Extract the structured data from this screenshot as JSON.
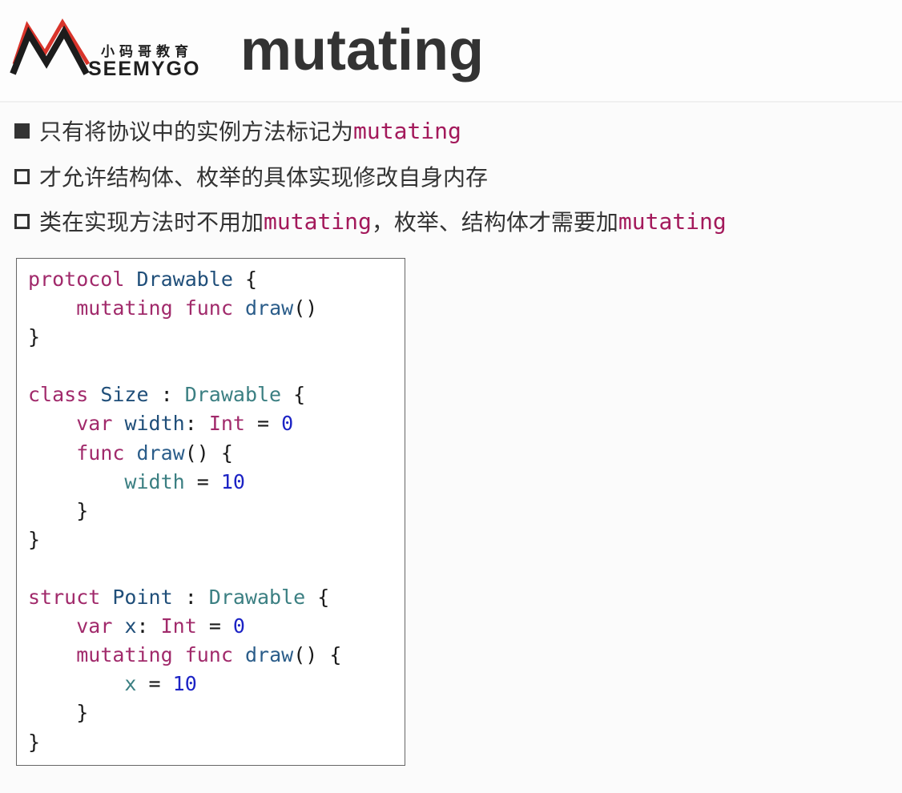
{
  "header": {
    "logo_cn": "小码哥教育",
    "logo_en": "SEEMYGO",
    "title": "mutating"
  },
  "bullets": [
    {
      "style": "filled",
      "text": "只有将协议中的实例方法标记为",
      "code1": "mutating",
      "text2": "",
      "code2": ""
    },
    {
      "style": "hollow",
      "text": "才允许结构体、枚举的具体实现修改自身内存",
      "code1": "",
      "text2": "",
      "code2": ""
    },
    {
      "style": "hollow",
      "text": "类在实现方法时不用加",
      "code1": "mutating",
      "text2": "，枚举、结构体才需要加",
      "code2": "mutating"
    }
  ],
  "code": {
    "lines": [
      [
        [
          "kw",
          "protocol"
        ],
        [
          "pl",
          " "
        ],
        [
          "ty",
          "Drawable"
        ],
        [
          "pl",
          " {"
        ]
      ],
      [
        [
          "pl",
          "    "
        ],
        [
          "kw",
          "mutating"
        ],
        [
          "pl",
          " "
        ],
        [
          "kw",
          "func"
        ],
        [
          "pl",
          " "
        ],
        [
          "fn",
          "draw"
        ],
        [
          "pl",
          "()"
        ]
      ],
      [
        [
          "pl",
          "}"
        ]
      ],
      [
        [
          "pl",
          ""
        ]
      ],
      [
        [
          "kw",
          "class"
        ],
        [
          "pl",
          " "
        ],
        [
          "ty",
          "Size"
        ],
        [
          "pl",
          " : "
        ],
        [
          "tyref",
          "Drawable"
        ],
        [
          "pl",
          " {"
        ]
      ],
      [
        [
          "pl",
          "    "
        ],
        [
          "kw",
          "var"
        ],
        [
          "pl",
          " "
        ],
        [
          "ty",
          "width"
        ],
        [
          "pl",
          ": "
        ],
        [
          "kw",
          "Int"
        ],
        [
          "pl",
          " = "
        ],
        [
          "num",
          "0"
        ]
      ],
      [
        [
          "pl",
          "    "
        ],
        [
          "kw",
          "func"
        ],
        [
          "pl",
          " "
        ],
        [
          "fn",
          "draw"
        ],
        [
          "pl",
          "() {"
        ]
      ],
      [
        [
          "pl",
          "        "
        ],
        [
          "var",
          "width"
        ],
        [
          "pl",
          " = "
        ],
        [
          "num",
          "10"
        ]
      ],
      [
        [
          "pl",
          "    }"
        ]
      ],
      [
        [
          "pl",
          "}"
        ]
      ],
      [
        [
          "pl",
          ""
        ]
      ],
      [
        [
          "kw",
          "struct"
        ],
        [
          "pl",
          " "
        ],
        [
          "ty",
          "Point"
        ],
        [
          "pl",
          " : "
        ],
        [
          "tyref",
          "Drawable"
        ],
        [
          "pl",
          " {"
        ]
      ],
      [
        [
          "pl",
          "    "
        ],
        [
          "kw",
          "var"
        ],
        [
          "pl",
          " "
        ],
        [
          "ty",
          "x"
        ],
        [
          "pl",
          ": "
        ],
        [
          "kw",
          "Int"
        ],
        [
          "pl",
          " = "
        ],
        [
          "num",
          "0"
        ]
      ],
      [
        [
          "pl",
          "    "
        ],
        [
          "kw",
          "mutating"
        ],
        [
          "pl",
          " "
        ],
        [
          "kw",
          "func"
        ],
        [
          "pl",
          " "
        ],
        [
          "fn",
          "draw"
        ],
        [
          "pl",
          "() {"
        ]
      ],
      [
        [
          "pl",
          "        "
        ],
        [
          "var",
          "x"
        ],
        [
          "pl",
          " = "
        ],
        [
          "num",
          "10"
        ]
      ],
      [
        [
          "pl",
          "    }"
        ]
      ],
      [
        [
          "pl",
          "}"
        ]
      ]
    ]
  },
  "colors": {
    "keyword": "#a12a6b",
    "type": "#1f4e79",
    "type_ref": "#3b7f82",
    "function": "#2b5d8a",
    "number": "#1c23c5",
    "inline_code": "#a3195b",
    "logo_red": "#d9342b"
  }
}
